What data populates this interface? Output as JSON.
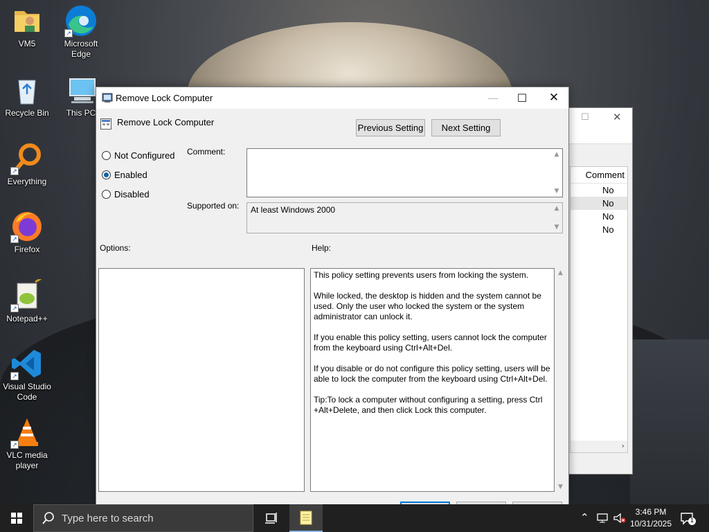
{
  "desktop": {
    "icons": [
      {
        "label": "VM5",
        "icon": "user-folder-icon"
      },
      {
        "label": "Microsoft Edge",
        "icon": "edge-icon"
      },
      {
        "label": "Recycle Bin",
        "icon": "recycle-bin-icon"
      },
      {
        "label": "This PC",
        "icon": "computer-icon"
      },
      {
        "label": "Everything",
        "icon": "everything-search-icon"
      },
      {
        "label": "Firefox",
        "icon": "firefox-icon"
      },
      {
        "label": "Notepad++",
        "icon": "notepadpp-icon"
      },
      {
        "label": "Visual Studio Code",
        "icon": "vscode-icon"
      },
      {
        "label": "VLC media player",
        "icon": "vlc-icon"
      }
    ]
  },
  "background_window": {
    "column_header": "Comment",
    "rows": [
      "No",
      "No",
      "No",
      "No"
    ]
  },
  "dialog": {
    "title": "Remove Lock Computer",
    "policy_name": "Remove Lock Computer",
    "previous_button": "Previous Setting",
    "next_button": "Next Setting",
    "radios": {
      "not_configured": "Not Configured",
      "enabled": "Enabled",
      "disabled": "Disabled",
      "selected": "enabled"
    },
    "comment_label": "Comment:",
    "comment_value": "",
    "supported_label": "Supported on:",
    "supported_value": "At least Windows 2000",
    "options_label": "Options:",
    "help_label": "Help:",
    "help_paragraphs": [
      "This policy setting prevents users from locking the system.",
      "While locked, the desktop is hidden and the system cannot be used. Only the user who locked the system or the system administrator can unlock it.",
      "If you enable this policy setting, users cannot lock the computer from the keyboard using Ctrl+Alt+Del.",
      "If you disable or do not configure this policy setting, users will be able to lock the computer from the keyboard using Ctrl+Alt+Del.",
      "Tip:To lock a computer without configuring a setting, press Ctrl +Alt+Delete, and then click Lock this computer."
    ]
  },
  "taskbar": {
    "search_placeholder": "Type here to search",
    "time": "3:46 PM",
    "date": "10/31/2025",
    "notification_count": "1"
  }
}
